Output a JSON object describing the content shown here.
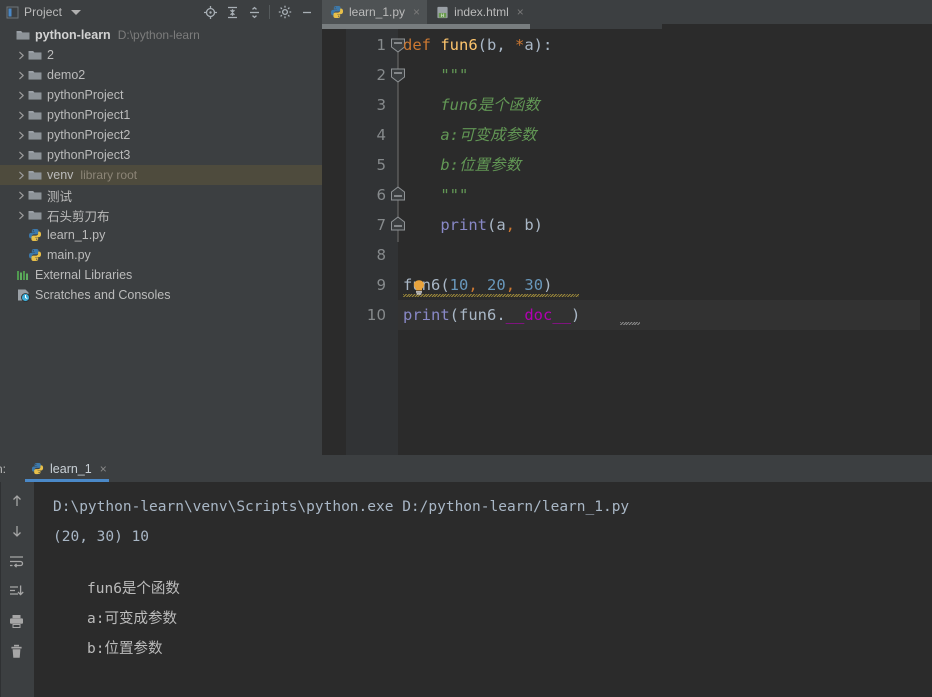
{
  "window": {
    "theme": "darcula",
    "colors": {
      "panel_bg": "#3c3f41",
      "editor_bg": "#2b2b2b",
      "gutter_bg": "#313335",
      "accent_blue": "#4a88c7",
      "selection_row": "#4e4b3d",
      "keyword_orange": "#cc7832",
      "function_yellow": "#ffc66d",
      "string_green": "#629755",
      "number_blue": "#6897bb",
      "builtin_purple": "#8888c6",
      "dunder_magenta": "#b200b2",
      "text_gray": "#a9b7c6"
    }
  },
  "project_panel": {
    "title": "Project",
    "icons": {
      "panel": "project-panel-icon",
      "caret": "chevron-down-icon",
      "locate": "locate-target-icon",
      "expand_all": "expand-all-icon",
      "collapse_all": "collapse-all-icon",
      "settings": "gear-icon",
      "hide": "minimize-icon"
    },
    "tree": [
      {
        "label": "python-learn",
        "secondary": "D:\\python-learn",
        "icon": "folder-icon",
        "indent": 0,
        "arrow": false,
        "bold": true,
        "selected": false
      },
      {
        "label": "2",
        "secondary": "",
        "icon": "folder-icon",
        "indent": 1,
        "arrow": true,
        "bold": false,
        "selected": false
      },
      {
        "label": "demo2",
        "secondary": "",
        "icon": "folder-icon",
        "indent": 1,
        "arrow": true,
        "bold": false,
        "selected": false
      },
      {
        "label": "pythonProject",
        "secondary": "",
        "icon": "folder-icon",
        "indent": 1,
        "arrow": true,
        "bold": false,
        "selected": false
      },
      {
        "label": "pythonProject1",
        "secondary": "",
        "icon": "folder-icon",
        "indent": 1,
        "arrow": true,
        "bold": false,
        "selected": false
      },
      {
        "label": "pythonProject2",
        "secondary": "",
        "icon": "folder-icon",
        "indent": 1,
        "arrow": true,
        "bold": false,
        "selected": false
      },
      {
        "label": "pythonProject3",
        "secondary": "",
        "icon": "folder-icon",
        "indent": 1,
        "arrow": true,
        "bold": false,
        "selected": false
      },
      {
        "label": "venv",
        "secondary": "library root",
        "icon": "folder-icon",
        "indent": 1,
        "arrow": true,
        "bold": false,
        "selected": true
      },
      {
        "label": "测试",
        "secondary": "",
        "icon": "folder-icon",
        "indent": 1,
        "arrow": true,
        "bold": false,
        "selected": false
      },
      {
        "label": "石头剪刀布",
        "secondary": "",
        "icon": "folder-icon",
        "indent": 1,
        "arrow": true,
        "bold": false,
        "selected": false
      },
      {
        "label": "learn_1.py",
        "secondary": "",
        "icon": "python-file-icon",
        "indent": 1,
        "arrow": false,
        "bold": false,
        "selected": false
      },
      {
        "label": "main.py",
        "secondary": "",
        "icon": "python-file-icon",
        "indent": 1,
        "arrow": false,
        "bold": false,
        "selected": false
      },
      {
        "label": "External Libraries",
        "secondary": "",
        "icon": "libraries-icon",
        "indent": 0,
        "arrow": false,
        "bold": false,
        "selected": false
      },
      {
        "label": "Scratches and Consoles",
        "secondary": "",
        "icon": "scratches-icon",
        "indent": 0,
        "arrow": false,
        "bold": false,
        "selected": false
      }
    ]
  },
  "editor": {
    "tabs": [
      {
        "label": "learn_1.py",
        "icon": "python-file-icon",
        "active": true,
        "close": "×"
      },
      {
        "label": "index.html",
        "icon": "html-file-icon",
        "active": false,
        "close": "×"
      }
    ],
    "line_numbers": [
      "1",
      "2",
      "3",
      "4",
      "5",
      "6",
      "7",
      "8",
      "9",
      "10"
    ],
    "current_line": 10,
    "lines": [
      {
        "n": 1,
        "fold": "start",
        "tokens": [
          {
            "t": "def ",
            "c": "kw"
          },
          {
            "t": "fun6",
            "c": "fn"
          },
          {
            "t": "(b, ",
            "c": "pun"
          },
          {
            "t": "*",
            "c": "op"
          },
          {
            "t": "a):",
            "c": "pun"
          }
        ]
      },
      {
        "n": 2,
        "fold": "start",
        "tokens": [
          {
            "t": "    \"\"\"",
            "c": "str"
          }
        ]
      },
      {
        "n": 3,
        "fold": "none",
        "tokens": [
          {
            "t": "    fun6是个函数",
            "c": "str"
          }
        ]
      },
      {
        "n": 4,
        "fold": "none",
        "tokens": [
          {
            "t": "    a:可变成参数",
            "c": "str"
          }
        ]
      },
      {
        "n": 5,
        "fold": "none",
        "tokens": [
          {
            "t": "    b:位置参数",
            "c": "str"
          }
        ]
      },
      {
        "n": 6,
        "fold": "end",
        "tokens": [
          {
            "t": "    \"\"\"",
            "c": "str"
          }
        ]
      },
      {
        "n": 7,
        "fold": "end",
        "tokens": [
          {
            "t": "    ",
            "c": "plain"
          },
          {
            "t": "print",
            "c": "bfn"
          },
          {
            "t": "(a",
            "c": "pun"
          },
          {
            "t": ",",
            "c": "op"
          },
          {
            "t": " b)",
            "c": "pun"
          }
        ]
      },
      {
        "n": 8,
        "fold": "none",
        "tokens": [
          {
            "t": "",
            "c": "plain"
          }
        ]
      },
      {
        "n": 9,
        "fold": "none",
        "warning": true,
        "tokens": [
          {
            "t": "fun6",
            "c": "plain"
          },
          {
            "t": "(",
            "c": "pun"
          },
          {
            "t": "10",
            "c": "num"
          },
          {
            "t": ",",
            "c": "op"
          },
          {
            "t": " ",
            "c": "pun"
          },
          {
            "t": "20",
            "c": "num"
          },
          {
            "t": ",",
            "c": "op"
          },
          {
            "t": " ",
            "c": "pun"
          },
          {
            "t": "30",
            "c": "num"
          },
          {
            "t": ")",
            "c": "pun"
          }
        ]
      },
      {
        "n": 10,
        "fold": "none",
        "current": true,
        "tokens": [
          {
            "t": "print",
            "c": "bfn"
          },
          {
            "t": "(fun6.",
            "c": "pun"
          },
          {
            "t": "__doc__",
            "c": "dun"
          },
          {
            "t": ")",
            "c": "pun"
          }
        ]
      }
    ]
  },
  "run_panel": {
    "label": "n:",
    "full_label": "Run:",
    "tab": {
      "label": "learn_1",
      "icon": "python-file-icon",
      "close": "×"
    },
    "toolbar_icons": [
      "arrow-up-icon",
      "arrow-down-icon",
      "soft-wrap-icon",
      "scroll-to-end-icon",
      "print-icon",
      "trash-icon"
    ],
    "console_lines": [
      {
        "text": "D:\\python-learn\\venv\\Scripts\\python.exe D:/python-learn/learn_1.py",
        "style": "path"
      },
      {
        "text": "(20, 30) 10",
        "style": "path"
      },
      {
        "text": "",
        "style": "blank"
      },
      {
        "text": "fun6是个函数",
        "style": "cjk"
      },
      {
        "text": "a:可变成参数",
        "style": "cjk"
      },
      {
        "text": "b:位置参数",
        "style": "cjk"
      }
    ]
  }
}
